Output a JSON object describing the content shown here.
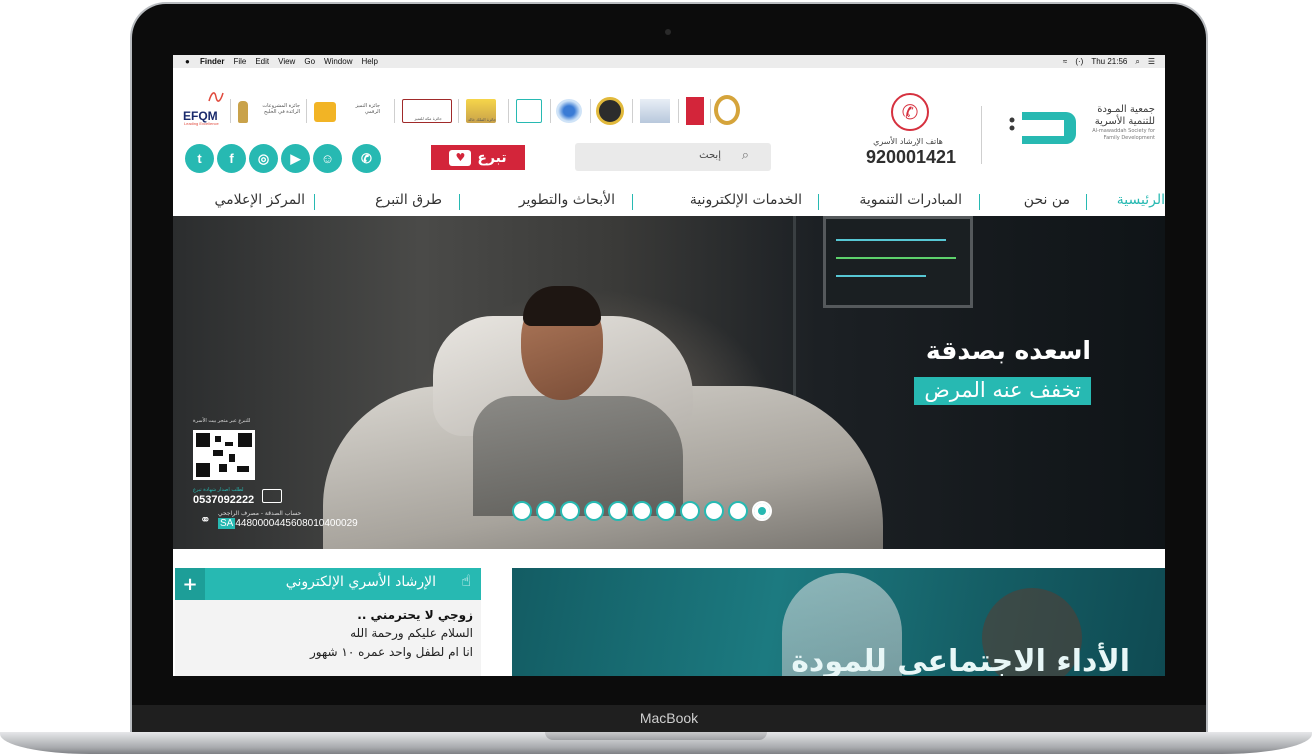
{
  "device": {
    "label": "MacBook"
  },
  "menubar": {
    "items": [
      "Finder",
      "File",
      "Edit",
      "View",
      "Go",
      "Window",
      "Help"
    ],
    "status": {
      "battery": "(·)",
      "clock": "Thu 21:56"
    }
  },
  "header": {
    "org_name_line1": "جمعية المـودة",
    "org_name_line2": "للتنمية الأسرية",
    "org_name_en": "Al-mawaddah Society for Family Development",
    "hotline_label": "هاتف الإرشاد الأسري",
    "hotline_number": "920001421",
    "awards": {
      "efqm": "EFQM",
      "efqm_sub": "Leading Excellence",
      "award1": "جائزة المشروعات الرائدة في الخليج",
      "award2": "جائزة التميز الرقمي",
      "award3": "جائزة مكة للتميز",
      "award4": "جائزة الملك خالد"
    },
    "search": {
      "placeholder": "إبحث"
    },
    "donate": {
      "label": "تبرع"
    }
  },
  "colors": {
    "accent": "#27b9b2",
    "donate": "#d3253a",
    "hotline": "#d6313f"
  },
  "socials": [
    {
      "name": "twitter",
      "glyph": "t"
    },
    {
      "name": "facebook",
      "glyph": "f"
    },
    {
      "name": "instagram",
      "glyph": "◎"
    },
    {
      "name": "youtube",
      "glyph": "▶"
    },
    {
      "name": "snapchat",
      "glyph": "☺"
    },
    {
      "name": "whatsapp",
      "glyph": "✆"
    }
  ],
  "nav": {
    "items": [
      "الرئيسية",
      "من نحن",
      "المبادرات التنموية",
      "الخدمات الإلكترونية",
      "الأبحاث والتطوير",
      "طرق التبرع",
      "المركز الإعلامي"
    ],
    "active": "الرئيسية"
  },
  "hero": {
    "title": "اسعده بصدقة",
    "subtitle": "تخفف عنه المرض",
    "qr_caption": "للتبرع عبر متجر بيت الأسرة",
    "sms_caption": "لطلب اصدار شهادة تبرع",
    "sms_number": "0537092222",
    "account_caption": "حساب الصدقة - مصرف الراجحي",
    "iban_prefix": "SA",
    "iban_rest": "4480000445608010400029",
    "slides_count": 11,
    "active_slide": 11
  },
  "counseling": {
    "title": "الإرشاد الأسري الإلكتروني",
    "question_title": "زوجي لا يحترمني ..",
    "line1": "السلام عليكم ورحمة الله",
    "line2": "انا ام لطفل واحد عمره ١٠ شهور"
  },
  "video": {
    "title": "الأداء الاجتماعي للمودة"
  }
}
